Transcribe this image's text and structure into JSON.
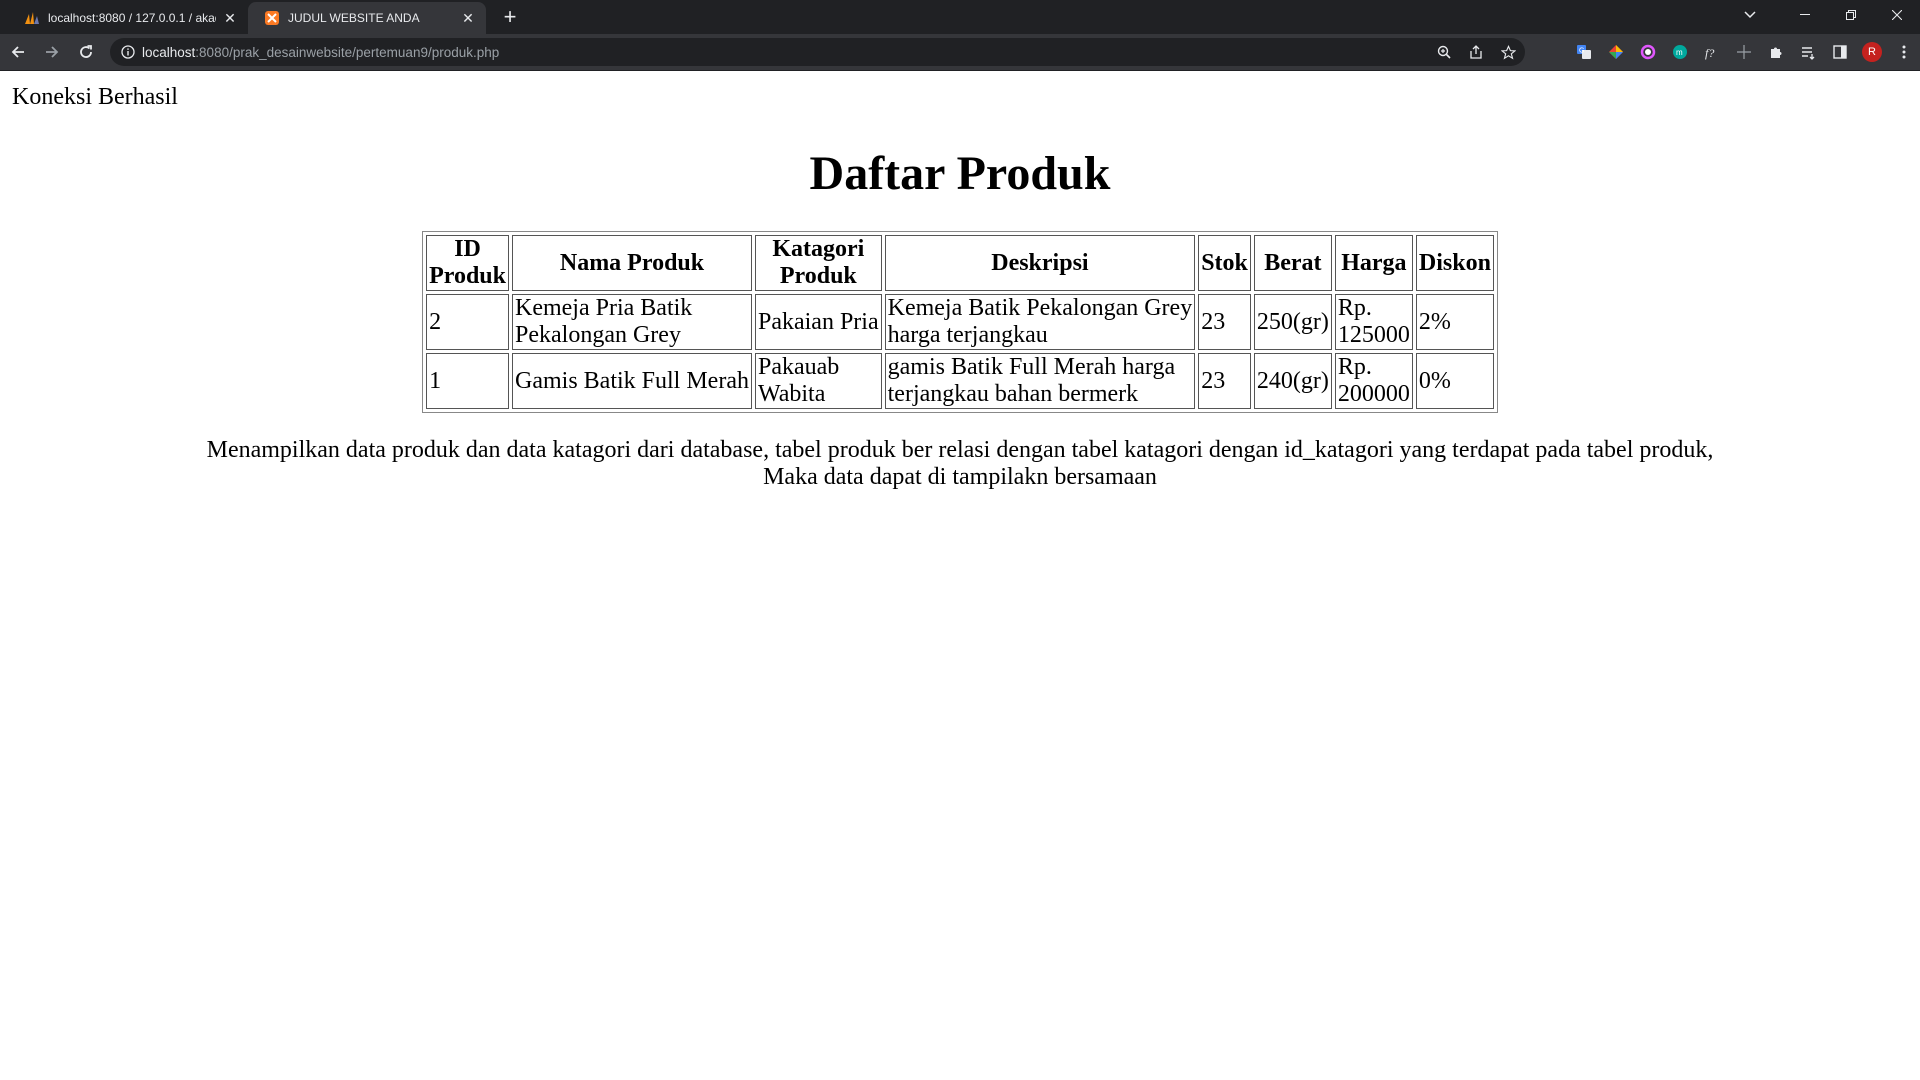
{
  "browser": {
    "tabs": [
      {
        "title": "localhost:8080 / 127.0.0.1 / akad",
        "active": false
      },
      {
        "title": "JUDUL WEBSITE ANDA",
        "active": true
      }
    ],
    "url": {
      "host": "localhost",
      "rest": ":8080/prak_desainwebsite/pertemuan9/produk.php"
    },
    "profile_initial": "R"
  },
  "page": {
    "status": "Koneksi Berhasil",
    "title": "Daftar Produk",
    "table": {
      "headers": [
        [
          "ID",
          "Produk"
        ],
        [
          "Nama Produk"
        ],
        [
          "Katagori",
          "Produk"
        ],
        [
          "Deskripsi"
        ],
        [
          "Stok"
        ],
        [
          "Berat"
        ],
        [
          "Harga"
        ],
        [
          "Diskon"
        ]
      ],
      "rows": [
        [
          [
            "2"
          ],
          [
            "Kemeja Pria Batik",
            "Pekalongan Grey"
          ],
          [
            "Pakaian Pria"
          ],
          [
            "Kemeja Batik Pekalongan Grey",
            "harga terjangkau"
          ],
          [
            "23"
          ],
          [
            "250(gr)"
          ],
          [
            "Rp.",
            "125000"
          ],
          [
            "2%"
          ]
        ],
        [
          [
            "1"
          ],
          [
            "Gamis Batik Full Merah"
          ],
          [
            "Pakauab",
            "Wabita"
          ],
          [
            "gamis Batik Full Merah harga",
            "terjangkau bahan bermerk"
          ],
          [
            "23"
          ],
          [
            "240(gr)"
          ],
          [
            "Rp.",
            "200000"
          ],
          [
            "0%"
          ]
        ]
      ]
    },
    "description": [
      "Menampilkan data produk dan data katagori dari database, tabel produk ber relasi dengan tabel katagori dengan id_katagori yang terdapat pada tabel produk,",
      "Maka data dapat di tampilakn bersamaan"
    ]
  }
}
